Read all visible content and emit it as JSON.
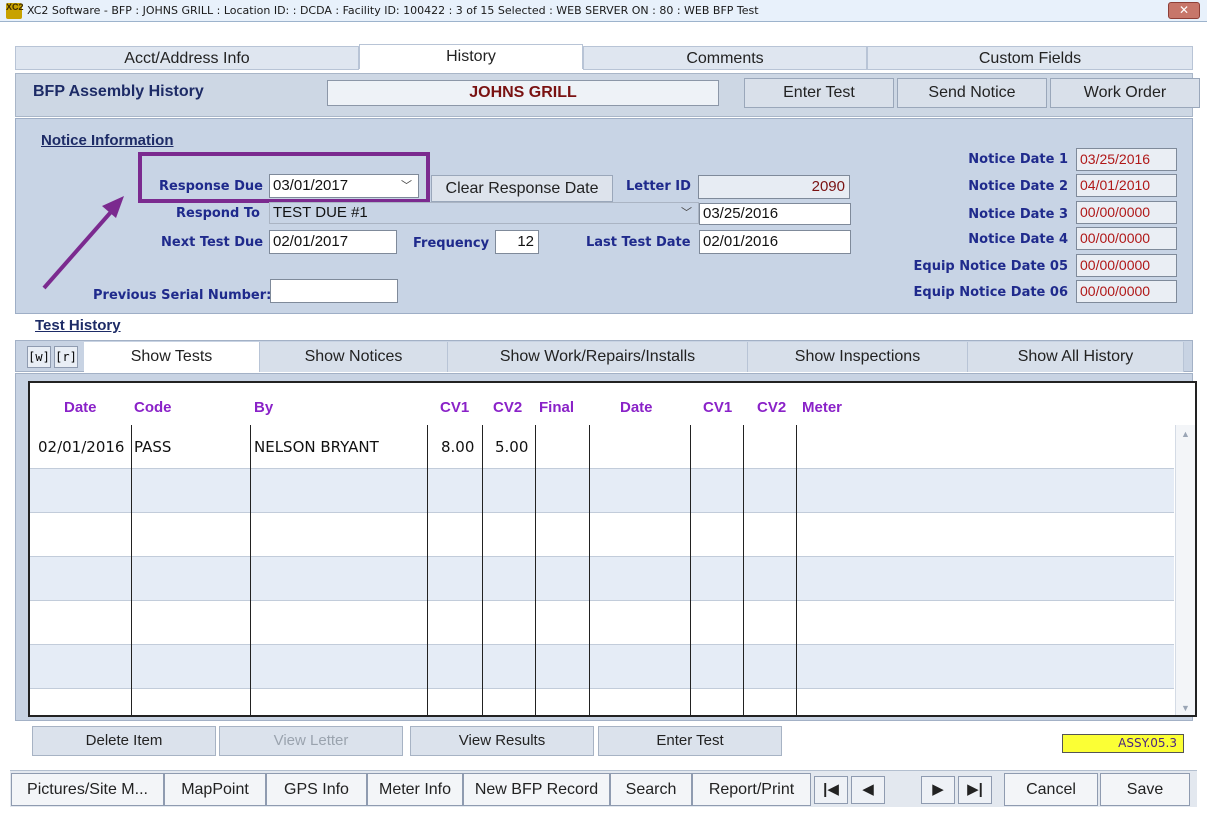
{
  "window": {
    "title": "XC2 Software - BFP : JOHNS GRILL : Location ID:  : DCDA : Facility ID:  100422 : 3 of 15 Selected : WEB SERVER ON : 80 : WEB BFP Test",
    "app_icon_text": "XC2",
    "close_glyph": "✕"
  },
  "main_tabs": [
    {
      "label": "Acct/Address Info"
    },
    {
      "label": "History"
    },
    {
      "label": "Comments"
    },
    {
      "label": "Custom Fields"
    }
  ],
  "header": {
    "section_label": "BFP Assembly History",
    "customer_name": "JOHNS GRILL",
    "buttons": {
      "enter_test": "Enter Test",
      "send_notice": "Send Notice",
      "work_order": "Work Order"
    }
  },
  "notice": {
    "title": "Notice Information",
    "response_due_label": "Response Due",
    "response_due_value": "03/01/2017",
    "clear_button": "Clear Response Date",
    "letter_id_label": "Letter ID",
    "letter_id_value": "2090",
    "respond_to_label": "Respond To",
    "respond_to_value": "TEST DUE #1",
    "respond_to_date": "03/25/2016",
    "next_test_due_label": "Next Test Due",
    "next_test_due_value": "02/01/2017",
    "frequency_label": "Frequency",
    "frequency_value": "12",
    "last_test_date_label": "Last Test Date",
    "last_test_date_value": "02/01/2016",
    "prev_serial_label": "Previous Serial Number:",
    "prev_serial_value": "",
    "notice_dates": [
      {
        "label": "Notice Date 1",
        "value": "03/25/2016"
      },
      {
        "label": "Notice Date 2",
        "value": "04/01/2010"
      },
      {
        "label": "Notice Date 3",
        "value": "00/00/0000"
      },
      {
        "label": "Notice Date 4",
        "value": "00/00/0000"
      },
      {
        "label": "Equip Notice Date 05",
        "value": "00/00/0000"
      },
      {
        "label": "Equip Notice Date 06",
        "value": "00/00/0000"
      }
    ],
    "highlight_color": "#7b2a8f"
  },
  "test_history": {
    "title": "Test History",
    "w_label": "[w]",
    "r_label": "[r]",
    "sub_tabs": [
      {
        "label": "Show Tests"
      },
      {
        "label": "Show Notices"
      },
      {
        "label": "Show Work/Repairs/Installs"
      },
      {
        "label": "Show Inspections"
      },
      {
        "label": "Show All History"
      }
    ],
    "columns": [
      "Date",
      "Code",
      "By",
      "CV1",
      "CV2",
      "Final",
      "Date",
      "CV1",
      "CV2",
      "Meter"
    ],
    "rows": [
      {
        "date": "02/01/2016",
        "code": "PASS",
        "by": "NELSON BRYANT",
        "cv1": "8.00",
        "cv2": "5.00",
        "final": "",
        "date2": "",
        "cv1b": "",
        "cv2b": "",
        "meter": ""
      }
    ]
  },
  "actions": {
    "delete_item": "Delete Item",
    "view_letter": "View Letter",
    "view_results": "View Results",
    "enter_test": "Enter Test",
    "assy_code": "ASSY.05.3"
  },
  "footer": {
    "buttons": [
      "Pictures/Site M...",
      "MapPoint",
      "GPS Info",
      "Meter Info",
      "New BFP Record",
      "Search",
      "Report/Print"
    ],
    "nav": {
      "first": "|◀",
      "prev": "◀",
      "next": "▶",
      "last": "▶|"
    },
    "cancel": "Cancel",
    "save": "Save"
  }
}
